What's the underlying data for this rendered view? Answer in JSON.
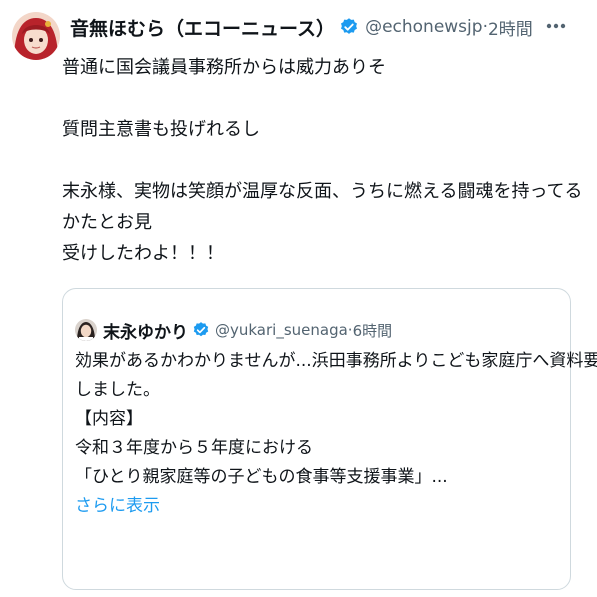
{
  "tweet": {
    "author_name": "音無ほむら（エコーニュース）",
    "handle": "@echonewsjp",
    "separator": "·",
    "time": "2時間",
    "body_lines": [
      "普通に国会議員事務所からは威力ありそ",
      "",
      "質問主意書も投げれるし",
      "",
      "末永様、実物は笑顔が温厚な反面、うちに燃える闘魂を持ってるかたとお見",
      "受けしたわよ！！！"
    ]
  },
  "quote": {
    "author_name": "末永ゆかり",
    "handle": "@yukari_suenaga",
    "separator": "·",
    "time": "6時間",
    "body_lines": [
      "効果があるかわかりませんが...浜田事務所よりこども家庭庁へ資料要求",
      "しました。",
      "【内容】",
      "令和３年度から５年度における",
      "「ひとり親家庭等の子どもの食事等支援事業」..."
    ],
    "show_more": "さらに表示"
  },
  "icons": {
    "verified": "verified-badge-icon",
    "more": "more-options-icon"
  },
  "colors": {
    "accent": "#1d9bf0",
    "text": "#0f1419",
    "muted": "#536471",
    "border": "#cfd9de"
  }
}
